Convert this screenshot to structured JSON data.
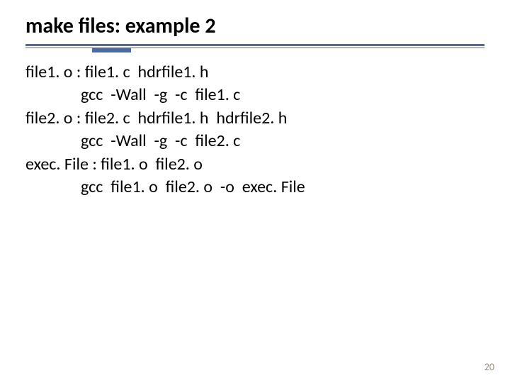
{
  "title": "make files: example 2",
  "lines": [
    {
      "indent": false,
      "text": "file1. o : file1. c  hdrfile1. h"
    },
    {
      "indent": true,
      "text": "gcc  -Wall  -g  -c  file1. c"
    },
    {
      "indent": false,
      "text": "file2. o : file2. c  hdrfile1. h  hdrfile2. h"
    },
    {
      "indent": true,
      "text": "gcc  -Wall  -g  -c  file2. c"
    },
    {
      "indent": false,
      "text": "exec. File : file1. o  file2. o"
    },
    {
      "indent": true,
      "text": "gcc  file1. o  file2. o  -o  exec. File"
    }
  ],
  "page_number": "20"
}
